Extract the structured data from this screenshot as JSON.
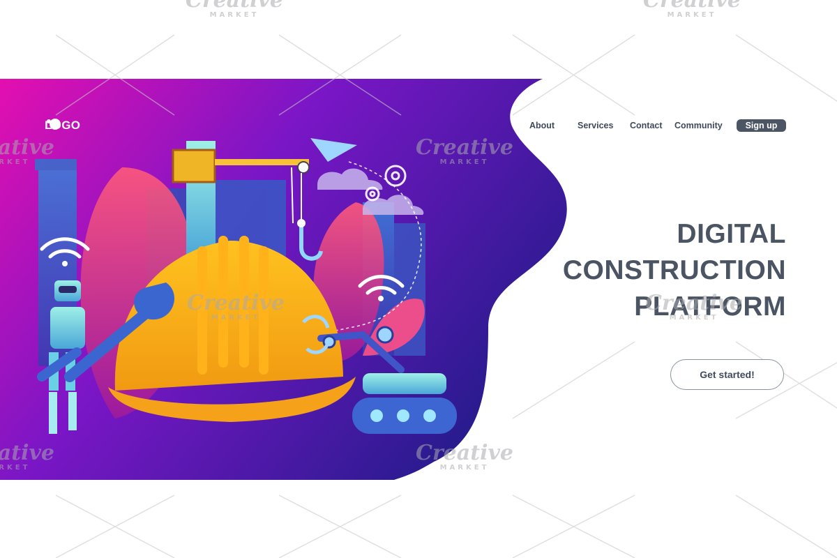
{
  "logo": {
    "text": "LOGO",
    "icon": "logo-icon"
  },
  "nav": {
    "links": [
      "About",
      "Services",
      "Contact",
      "Community"
    ],
    "signup_label": "Sign up"
  },
  "hero": {
    "title_lines": [
      "DIGITAL",
      "CONSTRUCTION",
      "PLATFORM"
    ],
    "cta_label": "Get started!"
  },
  "watermark": {
    "brand": "Creative",
    "sub": "MARKET"
  },
  "colors": {
    "gradient_start": "#d60fb4",
    "gradient_end": "#3a1a9e",
    "text_dark": "#4a5463",
    "signup_bg": "#4b5563",
    "helmet": "#f6b21b"
  }
}
